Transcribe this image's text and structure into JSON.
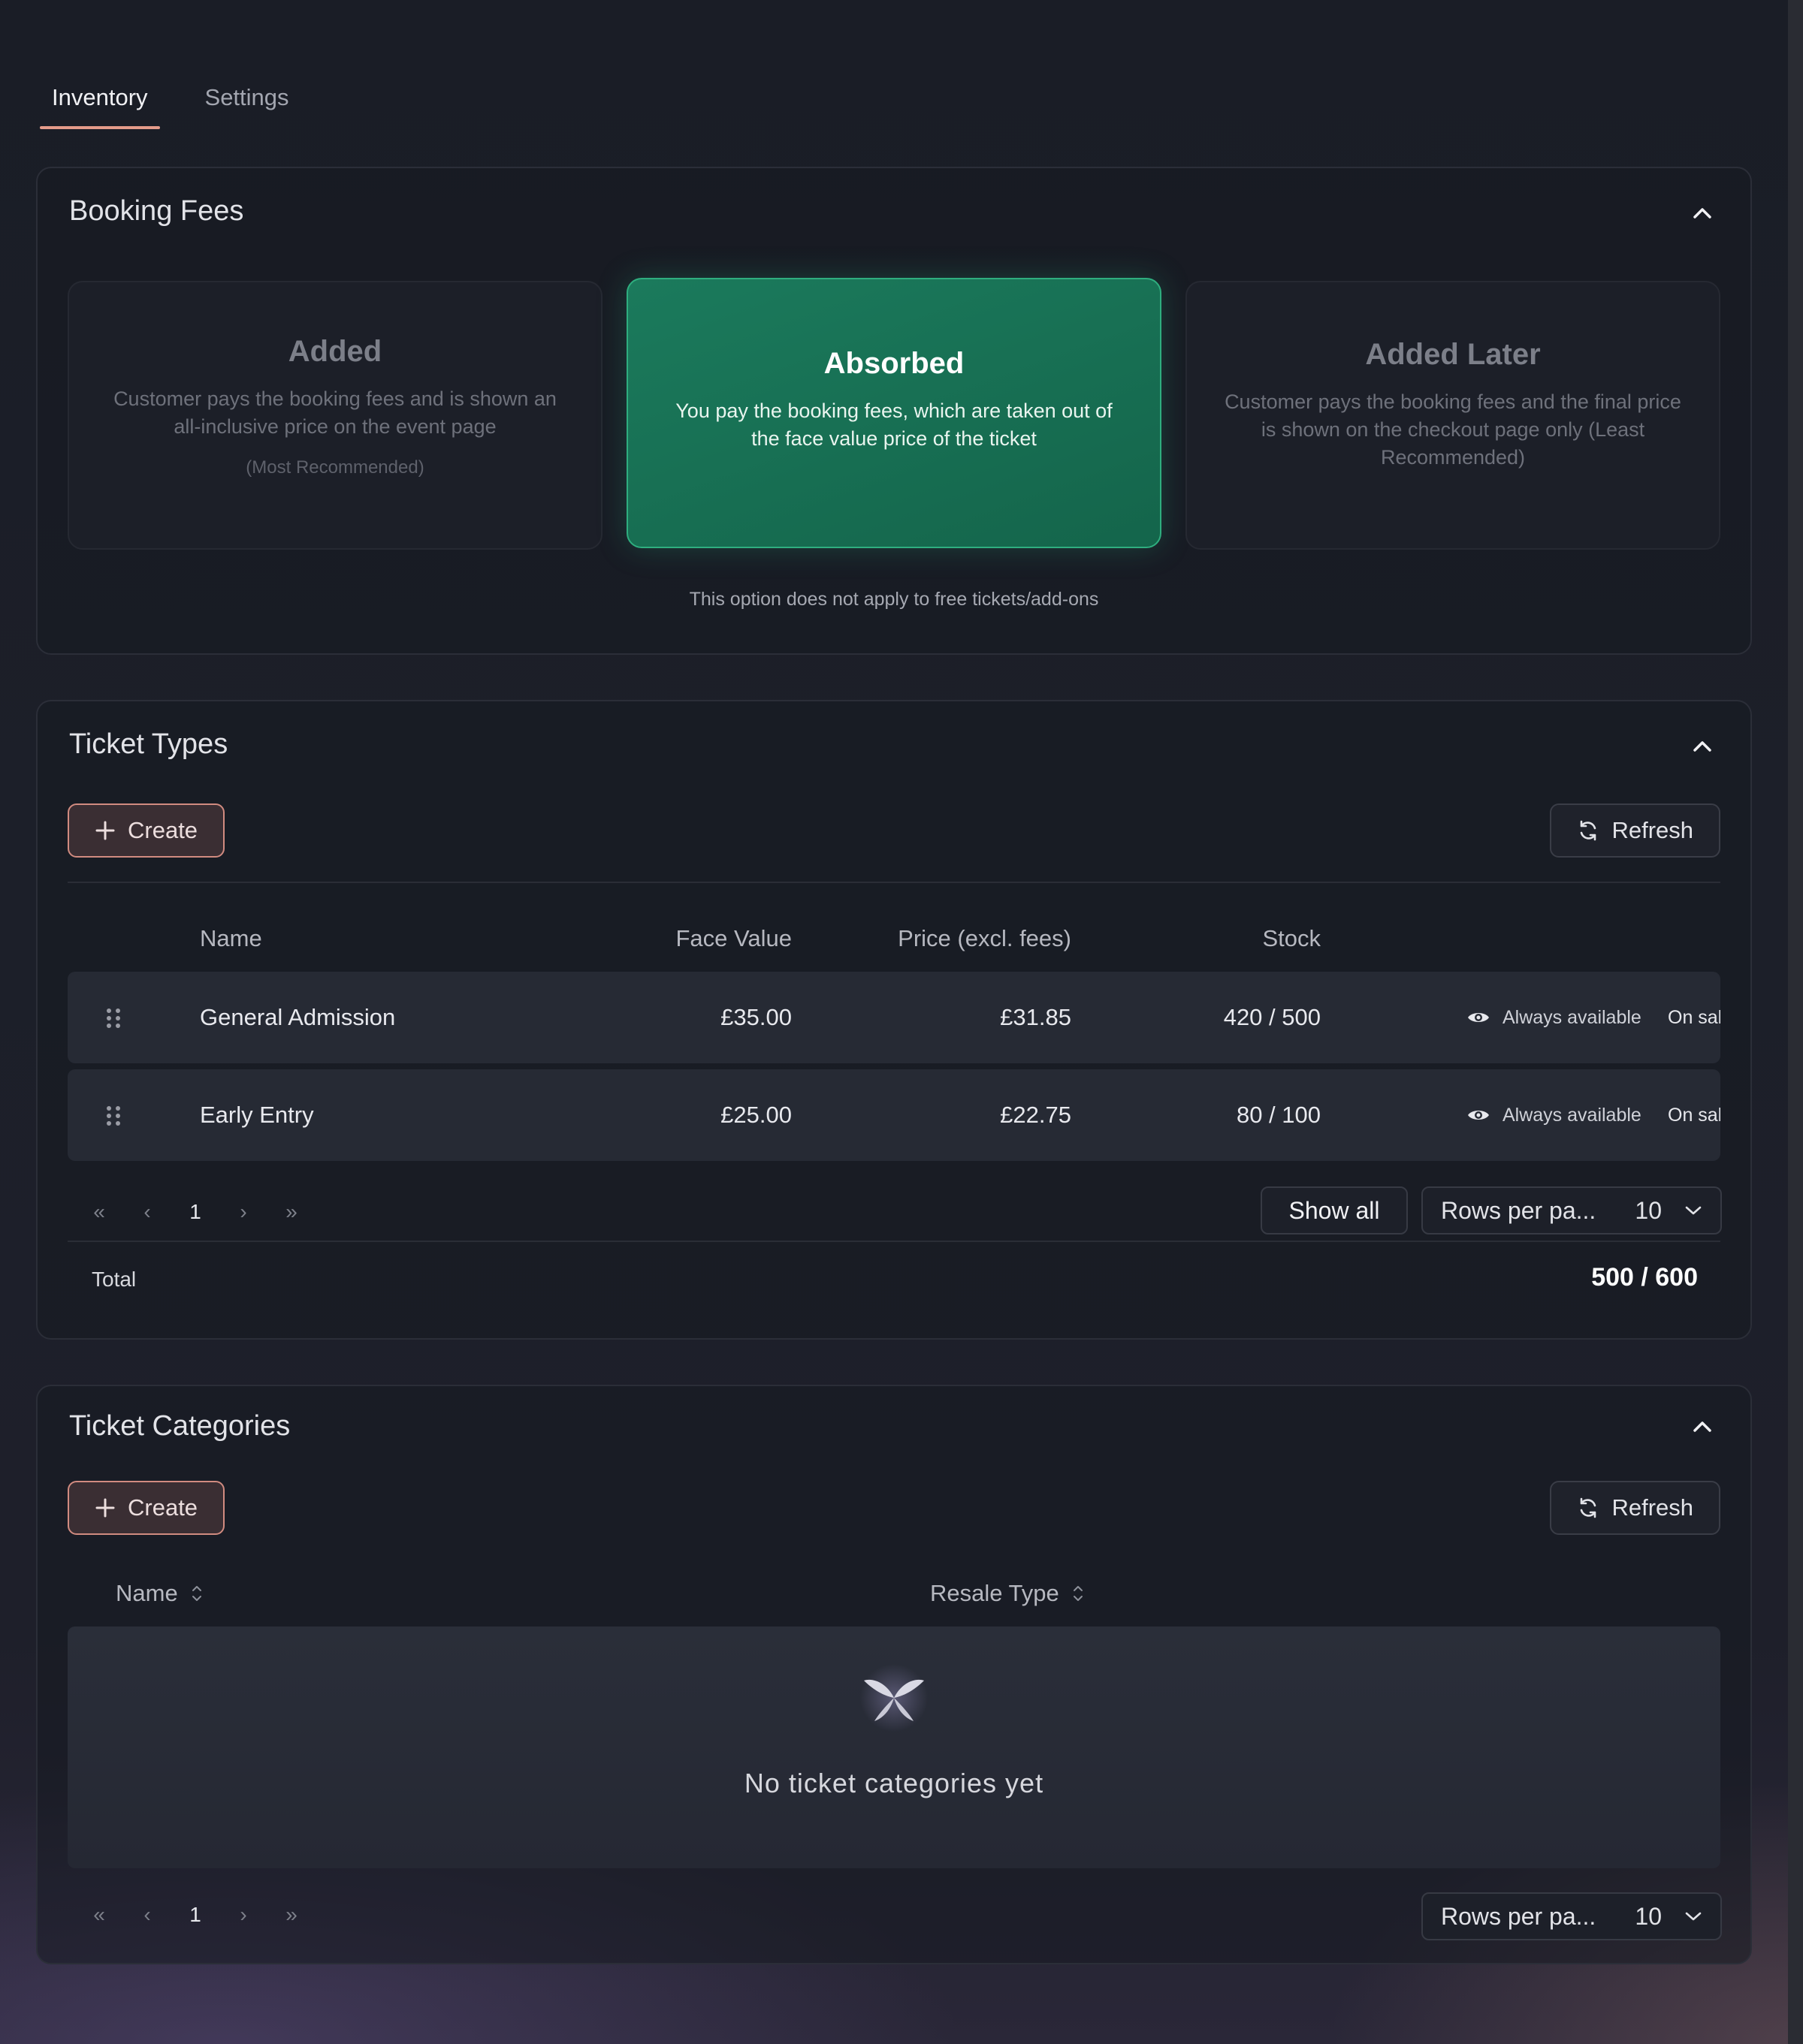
{
  "tabs": [
    {
      "label": "Inventory",
      "active": true
    },
    {
      "label": "Settings",
      "active": false
    }
  ],
  "booking_fees": {
    "title": "Booking Fees",
    "options": [
      {
        "title": "Added",
        "description": "Customer pays the booking fees and is shown an all-inclusive price on the event page",
        "note": "(Most Recommended)"
      },
      {
        "title": "Absorbed",
        "description": "You pay the booking fees, which are taken out of the face value price of the ticket",
        "selected": true
      },
      {
        "title": "Added Later",
        "description": "Customer pays the booking fees and the final price is shown on the checkout page only (Least Recommended)"
      }
    ],
    "note": "This option does not apply to free tickets/add-ons"
  },
  "ticket_types": {
    "title": "Ticket Types",
    "create_label": "Create",
    "refresh_label": "Refresh",
    "columns": [
      "Name",
      "Face Value",
      "Price (excl. fees)",
      "Stock"
    ],
    "rows": [
      {
        "name": "General Admission",
        "face_value": "£35.00",
        "price": "£31.85",
        "stock": "420 / 500",
        "availability": "Always available",
        "status": "On sal"
      },
      {
        "name": "Early Entry",
        "face_value": "£25.00",
        "price": "£22.75",
        "stock": "80 / 100",
        "availability": "Always available",
        "status": "On sal"
      }
    ],
    "pagination": {
      "first": "«",
      "prev": "‹",
      "page": "1",
      "next": "›",
      "last": "»"
    },
    "show_all_label": "Show all",
    "rows_per_page_label": "Rows per pa...",
    "rows_per_page_value": "10",
    "total_label": "Total",
    "total_value": "500 / 600"
  },
  "ticket_categories": {
    "title": "Ticket Categories",
    "create_label": "Create",
    "refresh_label": "Refresh",
    "columns": [
      "Name",
      "Resale Type"
    ],
    "empty_text": "No ticket categories yet",
    "pagination": {
      "first": "«",
      "prev": "‹",
      "page": "1",
      "next": "›",
      "last": "»"
    },
    "rows_per_page_label": "Rows per pa...",
    "rows_per_page_value": "10"
  },
  "colors": {
    "accent": "#e49b8a",
    "selected_card": "#1b7a5c",
    "background": "#1a1d26"
  }
}
